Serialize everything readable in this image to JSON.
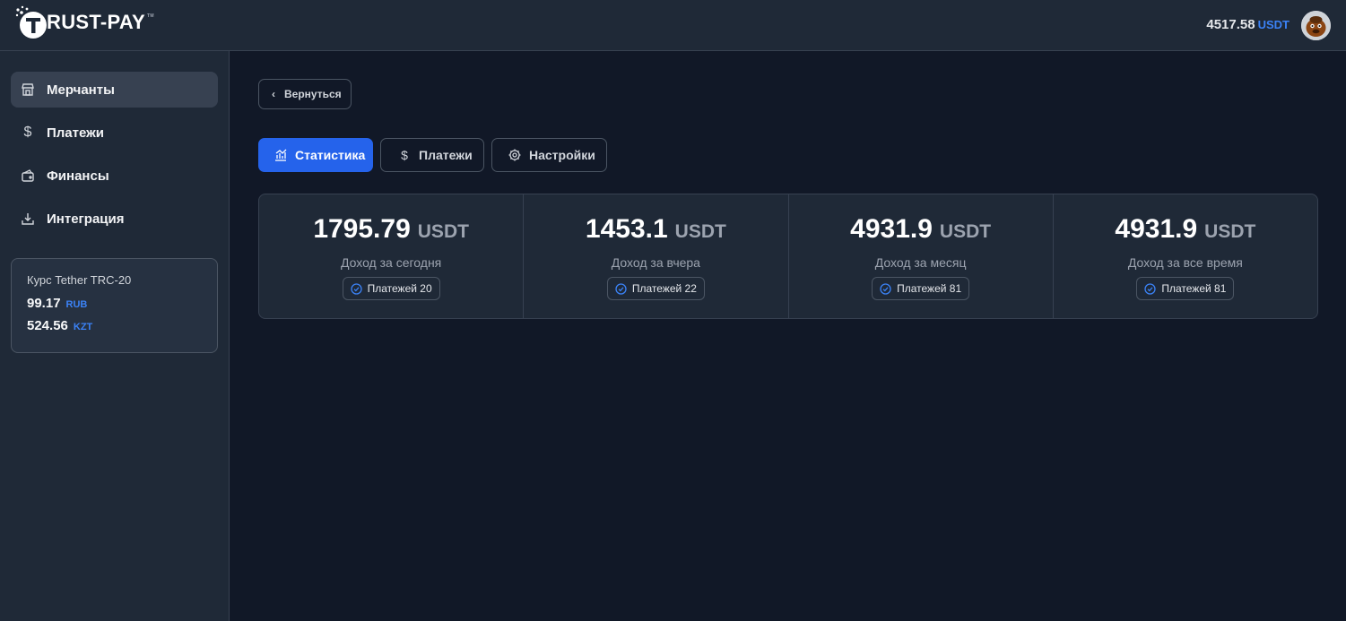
{
  "header": {
    "logo_text": "RUST-PAY",
    "logo_mark": "T",
    "logo_tm": "TM",
    "balance_value": "4517.58",
    "balance_unit": "USDT",
    "avatar_icon": "user-avatar"
  },
  "sidebar": {
    "items": [
      {
        "label": "Мерчанты",
        "icon": "store-icon",
        "active": true
      },
      {
        "label": "Платежи",
        "icon": "dollar-icon",
        "active": false
      },
      {
        "label": "Финансы",
        "icon": "wallet-icon",
        "active": false
      },
      {
        "label": "Интеграция",
        "icon": "download-icon",
        "active": false
      }
    ],
    "rate": {
      "title": "Курс Tether TRC-20",
      "rows": [
        {
          "value": "99.17",
          "currency": "RUB"
        },
        {
          "value": "524.56",
          "currency": "KZT"
        }
      ]
    }
  },
  "main": {
    "back_label": "Вернуться",
    "tabs": [
      {
        "label": "Статистика",
        "icon": "chart-icon",
        "active": true
      },
      {
        "label": "Платежи",
        "icon": "dollar-icon",
        "active": false
      },
      {
        "label": "Настройки",
        "icon": "gear-icon",
        "active": false
      }
    ],
    "stats": [
      {
        "value": "1795.79",
        "unit": "USDT",
        "label": "Доход за сегодня",
        "badge": "Платежей 20"
      },
      {
        "value": "1453.1",
        "unit": "USDT",
        "label": "Доход за вчера",
        "badge": "Платежей 22"
      },
      {
        "value": "4931.9",
        "unit": "USDT",
        "label": "Доход за месяц",
        "badge": "Платежей 81"
      },
      {
        "value": "4931.9",
        "unit": "USDT",
        "label": "Доход за все время",
        "badge": "Платежей 81"
      }
    ]
  },
  "colors": {
    "accent": "#2563eb",
    "unit_blue": "#3b82f6",
    "background": "#111827",
    "panel": "#1f2937"
  }
}
